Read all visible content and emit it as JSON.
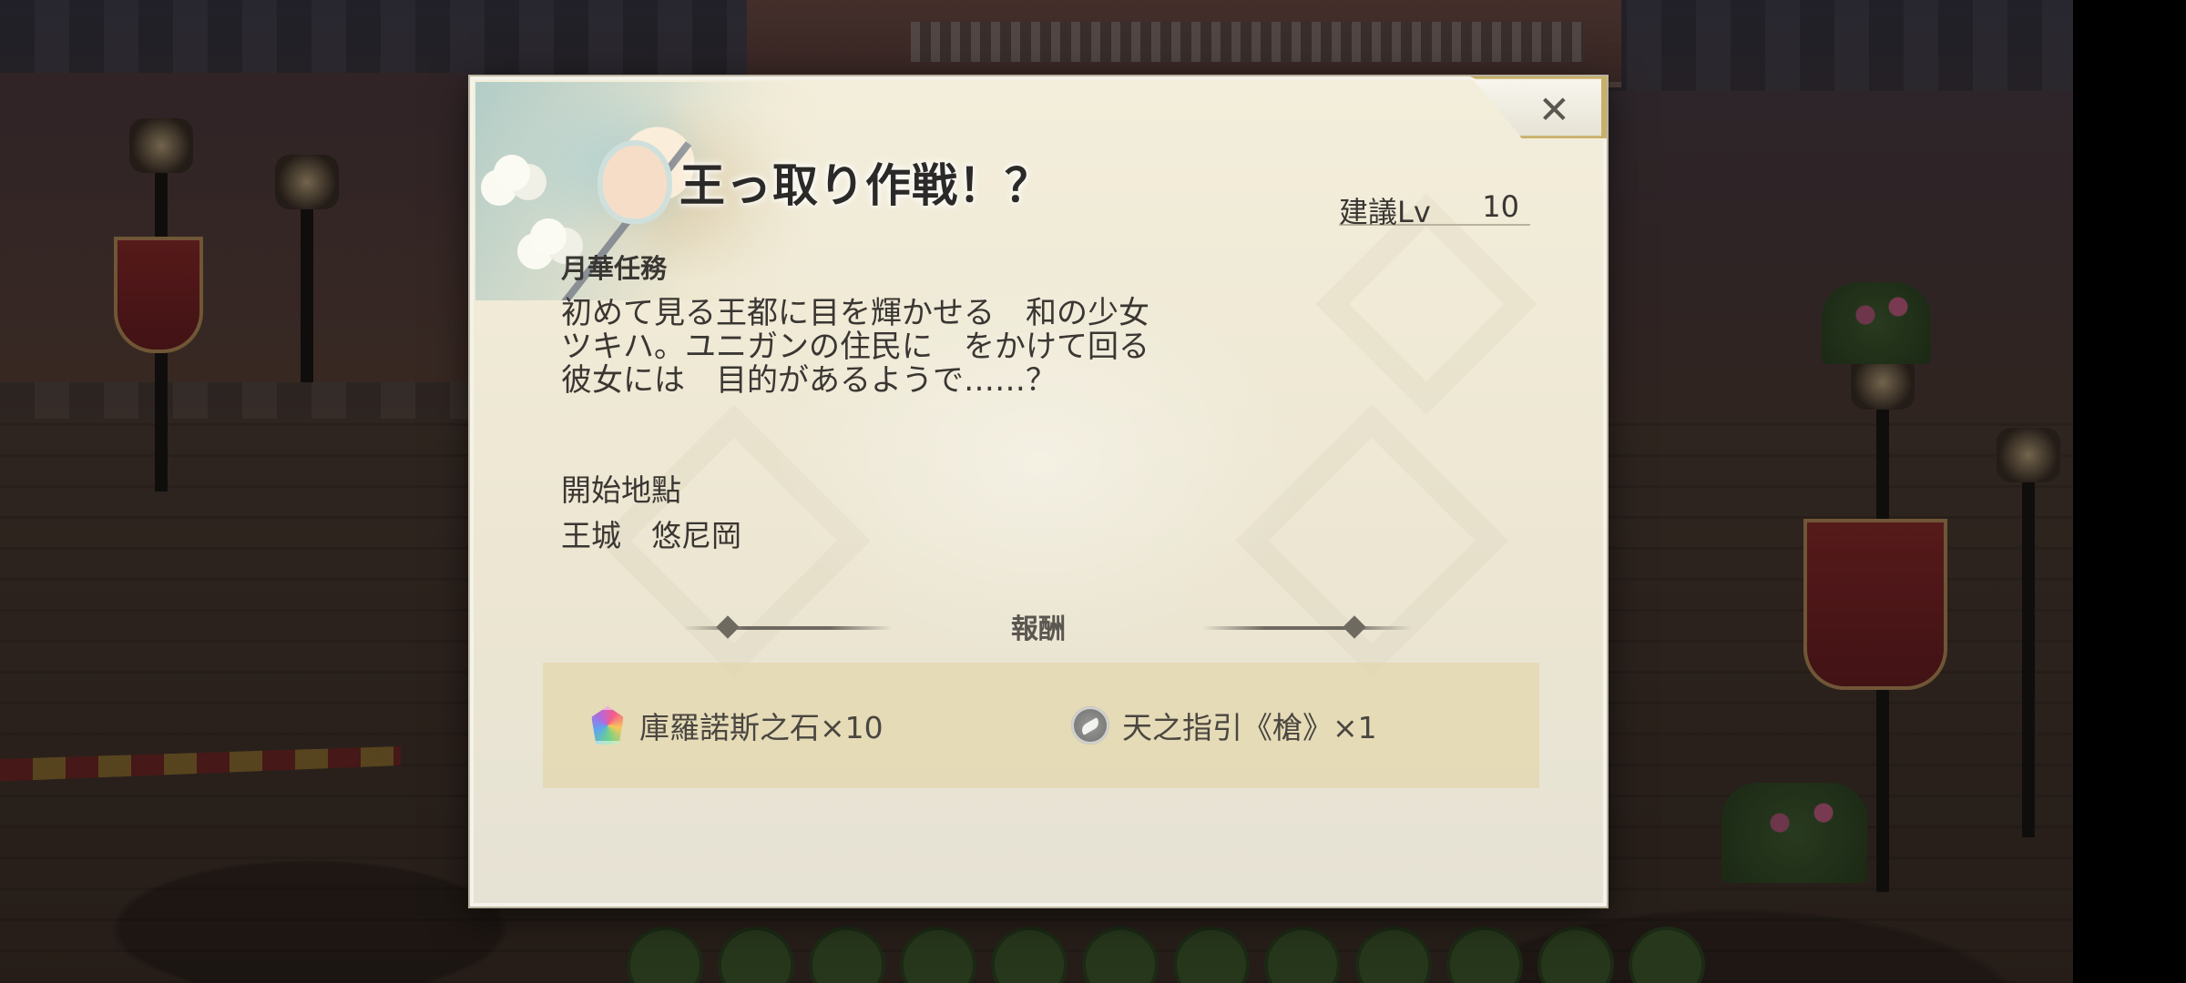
{
  "dialog": {
    "title": "王っ取り作戦！？",
    "level_label": "建議Lv",
    "level_value": "10",
    "category": "月華任務",
    "description_lines": [
      "初めて見る王都に目を輝かせる　和の少女",
      "ツキハ。ユニガンの住民に　をかけて回る",
      "彼女には　目的があるようで……？"
    ],
    "start_label": "開始地點",
    "start_value": "王城　悠尼岡",
    "reward_heading": "報酬",
    "rewards": [
      {
        "label": "庫羅諾斯之石×10",
        "icon": "chronos-stone-icon"
      },
      {
        "label": "天之指引《槍》×1",
        "icon": "feather-guide-icon"
      }
    ],
    "close_icon": "✕"
  }
}
